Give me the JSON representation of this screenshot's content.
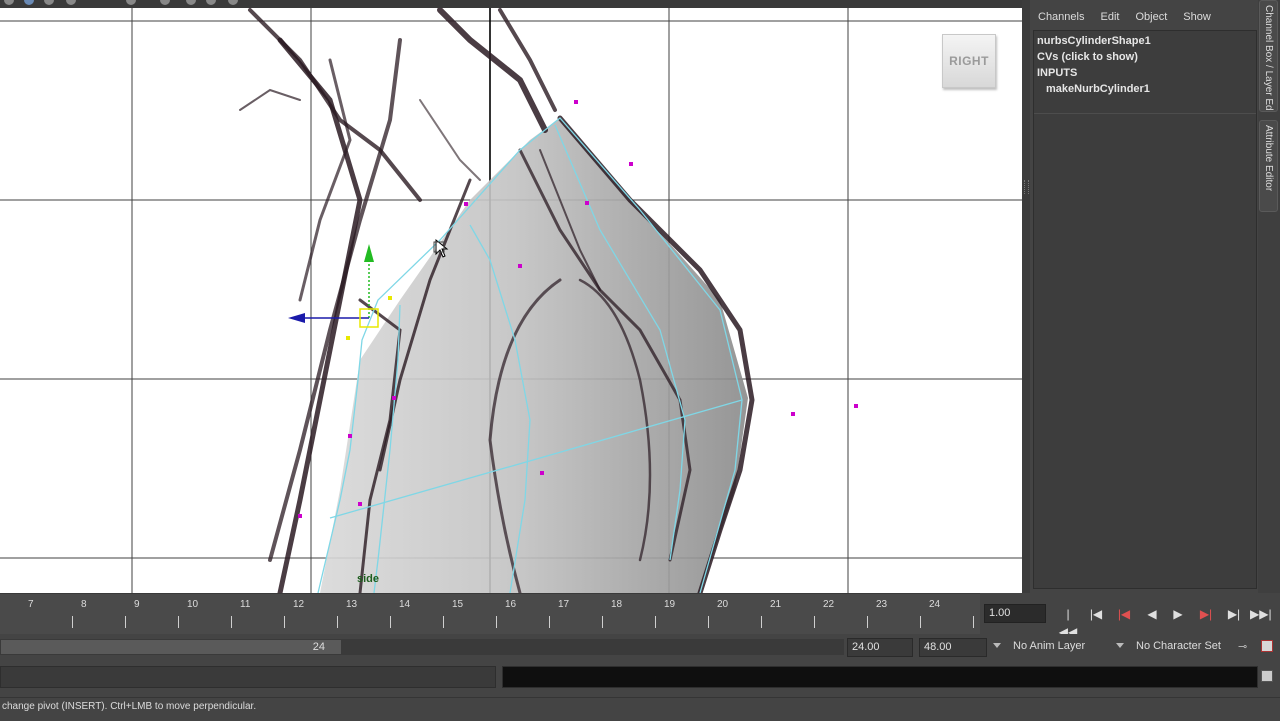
{
  "viewport": {
    "camera_label": "side",
    "view_cube_label": "RIGHT"
  },
  "channel_box": {
    "menu": [
      "Channels",
      "Edit",
      "Object",
      "Show"
    ],
    "shape_name": "nurbsCylinderShape1",
    "cvs_label": "CVs (click to show)",
    "inputs_label": "INPUTS",
    "input_node": "makeNurbCylinder1"
  },
  "side_tabs": {
    "channel_box_tab": "Channel Box / Layer Editor",
    "attribute_editor_tab": "Attribute Editor"
  },
  "timeline": {
    "frames": [
      7,
      8,
      9,
      10,
      11,
      12,
      13,
      14,
      15,
      16,
      17,
      18,
      19,
      20,
      21,
      22,
      23,
      24
    ]
  },
  "playback": {
    "current_frame": "1.00",
    "controls": [
      "go-to-start",
      "step-back-key",
      "step-back-frame",
      "play-backwards",
      "play-forwards",
      "step-forward-frame",
      "step-forward-key",
      "go-to-end"
    ]
  },
  "range": {
    "range_value": "24",
    "start_time": "24.00",
    "end_time": "48.00",
    "anim_layer": "No Anim Layer",
    "character_set": "No Character Set"
  },
  "help_line": "change pivot (INSERT).  Ctrl+LMB to move perpendicular.",
  "colors": {
    "cv_points": "#cc00cc",
    "curve": "#7fd7e6",
    "manipulator_y": "#22bb22",
    "manipulator_z": "#1a1aaa",
    "pivot": "#e8e800",
    "panel": "#444444"
  }
}
